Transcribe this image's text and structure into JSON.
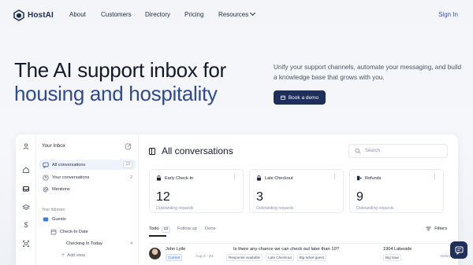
{
  "brand": {
    "name": "HostAI",
    "accent": "#1f2f5c",
    "highlight": "#2f4a8f"
  },
  "nav": {
    "about": "About",
    "customers": "Customers",
    "directory": "Directory",
    "pricing": "Pricing",
    "resources": "Resources",
    "signin": "Sign In"
  },
  "hero": {
    "title_line1": "The AI support inbox for",
    "title_line2": "housing and hospitality",
    "subtitle": "Unify your support channels, automate your messaging, and build a knowledge base that grows with you.",
    "cta": "Book a demo"
  },
  "app": {
    "sidebar": {
      "title": "Your Inbox",
      "items": [
        {
          "label": "All conversations",
          "count": "13"
        },
        {
          "label": "Your conversations",
          "count": "2"
        },
        {
          "label": "Mentions",
          "count": ""
        }
      ],
      "section_label": "Your Inboxes",
      "inboxes": [
        {
          "label": "Guests",
          "count": ""
        },
        {
          "label": "Check-In Date",
          "count": ""
        },
        {
          "label": "Checking In Today",
          "count": "4"
        },
        {
          "label": "Add view",
          "count": ""
        }
      ]
    },
    "main": {
      "title": "All conversations",
      "search_placeholder": "Search",
      "stats": [
        {
          "label": "Early Check-In",
          "value": "12",
          "caption": "Outstanding requests"
        },
        {
          "label": "Late Checkout",
          "value": "3",
          "caption": "Outstanding requests"
        },
        {
          "label": "Refunds",
          "value": "9",
          "caption": "Outstanding requests"
        }
      ],
      "tabs": {
        "todo": "Todo",
        "todo_count": "13",
        "follow_up": "Follow up",
        "done": "Done"
      },
      "filters": "Filters",
      "row": {
        "guest": "John Lytle",
        "status": "Current",
        "dates": "Aug 2 - 30",
        "message": "Is there any chance we can check out later than 10?",
        "tags": [
          "Response available",
          "Late Checkout",
          "Big ticket guest"
        ],
        "property": "1904 Lakeside",
        "property_tag": "Big Saw",
        "time": "Yesterday"
      }
    }
  }
}
